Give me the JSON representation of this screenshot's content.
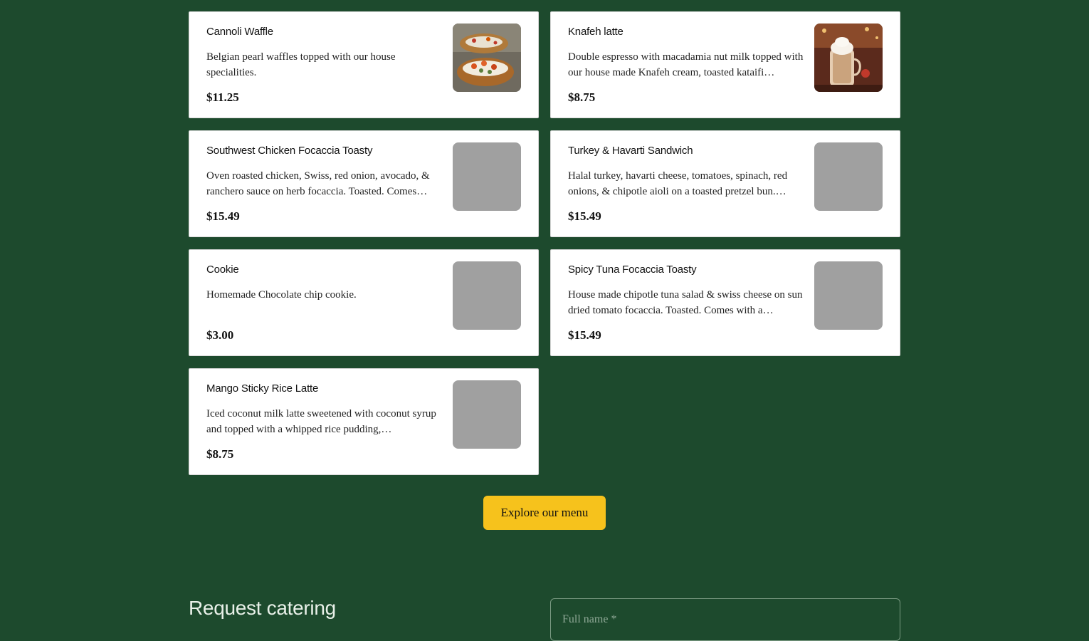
{
  "menu": {
    "items": [
      {
        "name": "Cannoli Waffle",
        "description": "Belgian pearl waffles topped with our house specialities.",
        "price": "$11.25",
        "image": "waffle-photo"
      },
      {
        "name": "Knafeh latte",
        "description": "Double espresso with macadamia nut milk topped with our house made Knafeh cream, toasted kataifi…",
        "price": "$8.75",
        "image": "latte-photo"
      },
      {
        "name": "Southwest Chicken Focaccia Toasty",
        "description": "Oven roasted chicken, Swiss, red onion, avocado, & ranchero sauce on herb focaccia. Toasted. Comes…",
        "price": "$15.49",
        "image": "placeholder"
      },
      {
        "name": "Turkey & Havarti Sandwich",
        "description": "Halal turkey, havarti cheese, tomatoes, spinach, red onions, & chipotle aioli on a toasted pretzel bun.…",
        "price": "$15.49",
        "image": "placeholder"
      },
      {
        "name": "Cookie",
        "description": "Homemade Chocolate chip cookie.",
        "price": "$3.00",
        "image": "placeholder"
      },
      {
        "name": "Spicy Tuna Focaccia Toasty",
        "description": "House made chipotle tuna salad & swiss cheese on sun dried tomato focaccia. Toasted. Comes with a…",
        "price": "$15.49",
        "image": "placeholder"
      },
      {
        "name": "Mango Sticky Rice Latte",
        "description": "Iced coconut milk latte sweetened with coconut syrup and topped with a whipped rice pudding,…",
        "price": "$8.75",
        "image": "placeholder"
      }
    ],
    "explore_label": "Explore our menu"
  },
  "catering": {
    "title": "Request catering",
    "full_name_placeholder": "Full name *"
  },
  "colors": {
    "background": "#1d4a2d",
    "card": "#ffffff",
    "button": "#f6c21c",
    "image_placeholder": "#a0a0a0"
  }
}
